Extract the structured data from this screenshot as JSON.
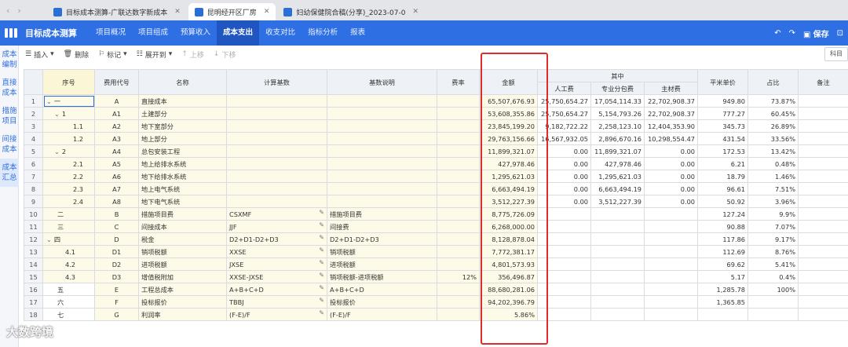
{
  "browser": {
    "tabs": [
      {
        "label": "目标成本测算-广联达数字新成本",
        "active": false
      },
      {
        "label": "昆明经开区厂房",
        "active": true
      },
      {
        "label": "妇幼保健院合稿(分享)_2023-07-0",
        "active": false
      }
    ]
  },
  "app": {
    "title": "目标成本测算",
    "menu": [
      "项目概况",
      "项目组成",
      "预算收入",
      "成本支出",
      "收支对比",
      "指标分析",
      "报表"
    ],
    "active_menu": "成本支出",
    "save_label": "保存",
    "accent": "#2f6fe4"
  },
  "leftnav": [
    "成本编制",
    "直接成本",
    "措施项目",
    "间接成本",
    "成本汇总"
  ],
  "toolbar": {
    "insert": "插入",
    "delete": "删除",
    "mark": "标记",
    "expand": "展开到",
    "up": "上移",
    "down": "下移",
    "right": "科目"
  },
  "table": {
    "headers": {
      "seq": "序号",
      "code": "费用代号",
      "name": "名称",
      "base": "计算基数",
      "desc": "基数说明",
      "rate": "费率",
      "amount": "金额",
      "group": "其中",
      "labor": "人工费",
      "sub": "专业分包费",
      "material": "主材费",
      "unit_price": "平米单价",
      "ratio": "占比",
      "note": "备注"
    },
    "rows": [
      {
        "n": "1",
        "seq": "一",
        "code": "A",
        "name": "直接成本",
        "base": "",
        "desc": "",
        "rate": "",
        "amount": "65,507,676.93",
        "labor": "25,750,654.27",
        "sub": "17,054,114.33",
        "material": "22,702,908.37",
        "unit": "949.80",
        "ratio": "73.87%",
        "indent": 0,
        "toggle": "⌄"
      },
      {
        "n": "2",
        "seq": "1",
        "code": "A1",
        "name": "土建部分",
        "base": "",
        "desc": "",
        "rate": "",
        "amount": "53,608,355.86",
        "labor": "25,750,654.27",
        "sub": "5,154,793.26",
        "material": "22,702,908.37",
        "unit": "777.27",
        "ratio": "60.45%",
        "indent": 1,
        "toggle": "⌄"
      },
      {
        "n": "3",
        "seq": "1.1",
        "code": "A2",
        "name": "地下室部分",
        "base": "",
        "desc": "",
        "rate": "",
        "amount": "23,845,199.20",
        "labor": "9,182,722.22",
        "sub": "2,258,123.10",
        "material": "12,404,353.90",
        "unit": "345.73",
        "ratio": "26.89%",
        "indent": 2,
        "toggle": ""
      },
      {
        "n": "4",
        "seq": "1.2",
        "code": "A3",
        "name": "地上部分",
        "base": "",
        "desc": "",
        "rate": "",
        "amount": "29,763,156.66",
        "labor": "16,567,932.05",
        "sub": "2,896,670.16",
        "material": "10,298,554.47",
        "unit": "431.54",
        "ratio": "33.56%",
        "indent": 2,
        "toggle": ""
      },
      {
        "n": "5",
        "seq": "2",
        "code": "A4",
        "name": "总包安装工程",
        "base": "",
        "desc": "",
        "rate": "",
        "amount": "11,899,321.07",
        "labor": "0.00",
        "sub": "11,899,321.07",
        "material": "0.00",
        "unit": "172.53",
        "ratio": "13.42%",
        "indent": 1,
        "toggle": "⌄"
      },
      {
        "n": "6",
        "seq": "2.1",
        "code": "A5",
        "name": "地上给排水系统",
        "base": "",
        "desc": "",
        "rate": "",
        "amount": "427,978.46",
        "labor": "0.00",
        "sub": "427,978.46",
        "material": "0.00",
        "unit": "6.21",
        "ratio": "0.48%",
        "indent": 2,
        "toggle": ""
      },
      {
        "n": "7",
        "seq": "2.2",
        "code": "A6",
        "name": "地下给排水系统",
        "base": "",
        "desc": "",
        "rate": "",
        "amount": "1,295,621.03",
        "labor": "0.00",
        "sub": "1,295,621.03",
        "material": "0.00",
        "unit": "18.79",
        "ratio": "1.46%",
        "indent": 2,
        "toggle": ""
      },
      {
        "n": "8",
        "seq": "2.3",
        "code": "A7",
        "name": "地上电气系统",
        "base": "",
        "desc": "",
        "rate": "",
        "amount": "6,663,494.19",
        "labor": "0.00",
        "sub": "6,663,494.19",
        "material": "0.00",
        "unit": "96.61",
        "ratio": "7.51%",
        "indent": 2,
        "toggle": ""
      },
      {
        "n": "9",
        "seq": "2.4",
        "code": "A8",
        "name": "地下电气系统",
        "base": "",
        "desc": "",
        "rate": "",
        "amount": "3,512,227.39",
        "labor": "0.00",
        "sub": "3,512,227.39",
        "material": "0.00",
        "unit": "50.92",
        "ratio": "3.96%",
        "indent": 2,
        "toggle": ""
      },
      {
        "n": "10",
        "seq": "二",
        "code": "B",
        "name": "措施项目费",
        "base": "CSXMF",
        "desc": "措施项目费",
        "rate": "",
        "amount": "8,775,726.09",
        "labor": "",
        "sub": "",
        "material": "",
        "unit": "127.24",
        "ratio": "9.9%",
        "indent": 0,
        "toggle": "",
        "pen": true
      },
      {
        "n": "11",
        "seq": "三",
        "code": "C",
        "name": "间接成本",
        "base": "JJF",
        "desc": "间接费",
        "rate": "",
        "amount": "6,268,000.00",
        "labor": "",
        "sub": "",
        "material": "",
        "unit": "90.88",
        "ratio": "7.07%",
        "indent": 0,
        "toggle": "",
        "pen": true
      },
      {
        "n": "12",
        "seq": "四",
        "code": "D",
        "name": "税金",
        "base": "D2+D1-D2+D3",
        "desc": "D2+D1-D2+D3",
        "rate": "",
        "amount": "8,128,878.04",
        "labor": "",
        "sub": "",
        "material": "",
        "unit": "117.86",
        "ratio": "9.17%",
        "indent": 0,
        "toggle": "⌄",
        "pen": true
      },
      {
        "n": "13",
        "seq": "4.1",
        "code": "D1",
        "name": "销项税额",
        "base": "XXSE",
        "desc": "销项税额",
        "rate": "",
        "amount": "7,772,381.17",
        "labor": "",
        "sub": "",
        "material": "",
        "unit": "112.69",
        "ratio": "8.76%",
        "indent": 1,
        "toggle": "",
        "pen": true
      },
      {
        "n": "14",
        "seq": "4.2",
        "code": "D2",
        "name": "进项税额",
        "base": "JXSE",
        "desc": "进项税额",
        "rate": "",
        "amount": "4,801,573.93",
        "labor": "",
        "sub": "",
        "material": "",
        "unit": "69.62",
        "ratio": "5.41%",
        "indent": 1,
        "toggle": "",
        "pen": true
      },
      {
        "n": "15",
        "seq": "4.3",
        "code": "D3",
        "name": "增值税附加",
        "base": "XXSE-JXSE",
        "desc": "销项税额-进项税额",
        "rate": "12%",
        "amount": "356,496.87",
        "labor": "",
        "sub": "",
        "material": "",
        "unit": "5.17",
        "ratio": "0.4%",
        "indent": 1,
        "toggle": "",
        "pen": true
      },
      {
        "n": "16",
        "seq": "五",
        "code": "E",
        "name": "工程总成本",
        "base": "A+B+C+D",
        "desc": "A+B+C+D",
        "rate": "",
        "amount": "88,680,281.06",
        "labor": "",
        "sub": "",
        "material": "",
        "unit": "1,285.78",
        "ratio": "100%",
        "indent": 0,
        "toggle": "",
        "pen": true
      },
      {
        "n": "17",
        "seq": "六",
        "code": "F",
        "name": "投标报价",
        "base": "TBBJ",
        "desc": "投标报价",
        "rate": "",
        "amount": "94,202,396.79",
        "labor": "",
        "sub": "",
        "material": "",
        "unit": "1,365.85",
        "ratio": "",
        "indent": 0,
        "toggle": "",
        "pen": true
      },
      {
        "n": "18",
        "seq": "七",
        "code": "G",
        "name": "利润率",
        "base": "(F-E)/F",
        "desc": "(F-E)/F",
        "rate": "",
        "amount": "5.86%",
        "labor": "",
        "sub": "",
        "material": "",
        "unit": "",
        "ratio": "",
        "indent": 0,
        "toggle": "",
        "pen": true
      }
    ]
  },
  "watermark": "大数跨境"
}
